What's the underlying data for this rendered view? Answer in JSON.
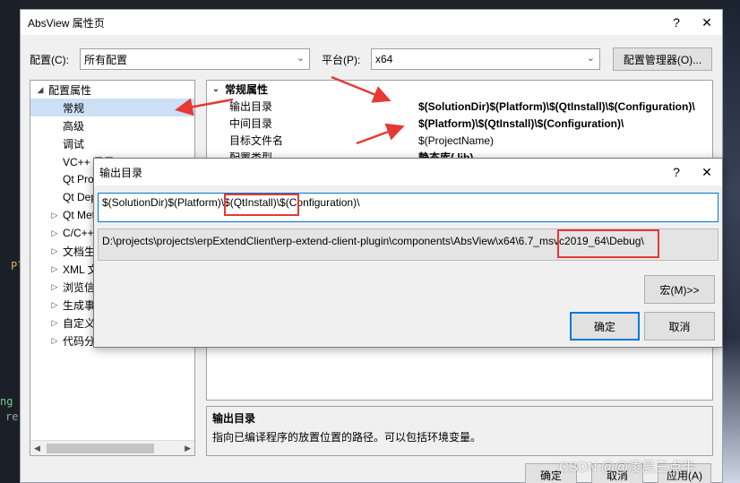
{
  "background": {
    "left_code": [
      "Pl",
      "ng",
      "re"
    ]
  },
  "window": {
    "title": "AbsView 属性页",
    "help_glyph": "?",
    "close_glyph": "✕"
  },
  "config": {
    "config_label": "配置(C):",
    "config_value": "所有配置",
    "platform_label": "平台(P):",
    "platform_value": "x64",
    "manager_button": "配置管理器(O)..."
  },
  "tree": {
    "items": [
      {
        "label": "配置属性",
        "exp": "◢"
      },
      {
        "label": "常规",
        "exp": ""
      },
      {
        "label": "高级",
        "exp": ""
      },
      {
        "label": "调试",
        "exp": ""
      },
      {
        "label": "VC++ 目录",
        "exp": ""
      },
      {
        "label": "Qt Project Settings",
        "exp": ""
      },
      {
        "label": "Qt Deploy",
        "exp": ""
      },
      {
        "label": "Qt Meta-Object Compiler",
        "exp": "▷"
      },
      {
        "label": "C/C++",
        "exp": "▷"
      },
      {
        "label": "文档生成器",
        "exp": "▷"
      },
      {
        "label": "XML 文档生成器",
        "exp": "▷"
      },
      {
        "label": "浏览信息",
        "exp": "▷"
      },
      {
        "label": "生成事件",
        "exp": "▷"
      },
      {
        "label": "自定义生成步骤",
        "exp": "▷"
      },
      {
        "label": "代码分析",
        "exp": "▷"
      }
    ]
  },
  "grid": {
    "section": "常规属性",
    "rows": [
      {
        "key": "输出目录",
        "value": "$(SolutionDir)$(Platform)\\$(QtInstall)\\$(Configuration)\\",
        "bold": true
      },
      {
        "key": "中间目录",
        "value": "$(Platform)\\$(QtInstall)\\$(Configuration)\\",
        "bold": true
      },
      {
        "key": "目标文件名",
        "value": "$(ProjectName)",
        "bold": false
      },
      {
        "key": "配置类型",
        "value": "静态库(.lib)",
        "bold": true
      }
    ]
  },
  "description": {
    "title": "输出目录",
    "text": "指向已编译程序的放置位置的路径。可以包括环境变量。"
  },
  "bottom_buttons": {
    "ok": "确定",
    "cancel": "取消",
    "apply": "应用(A)"
  },
  "dialog": {
    "title": "输出目录",
    "help_glyph": "?",
    "close_glyph": "✕",
    "edit_value": "$(SolutionDir)$(Platform)\\$(QtInstall)\\$(Configuration)\\",
    "evaluated_value": "D:\\projects\\projects\\erpExtendClient\\erp-extend-client-plugin\\components\\AbsView\\x64\\6.7_msvc2019_64\\Debug\\",
    "macros_button": "宏(M)>>",
    "ok_button": "确定",
    "cancel_button": "取消"
  },
  "colors": {
    "annotation_red": "#e53935",
    "selection_blue": "#cce0f5",
    "focus_blue": "#0078d7"
  },
  "watermark": "CSDN @@凌晨三点半"
}
